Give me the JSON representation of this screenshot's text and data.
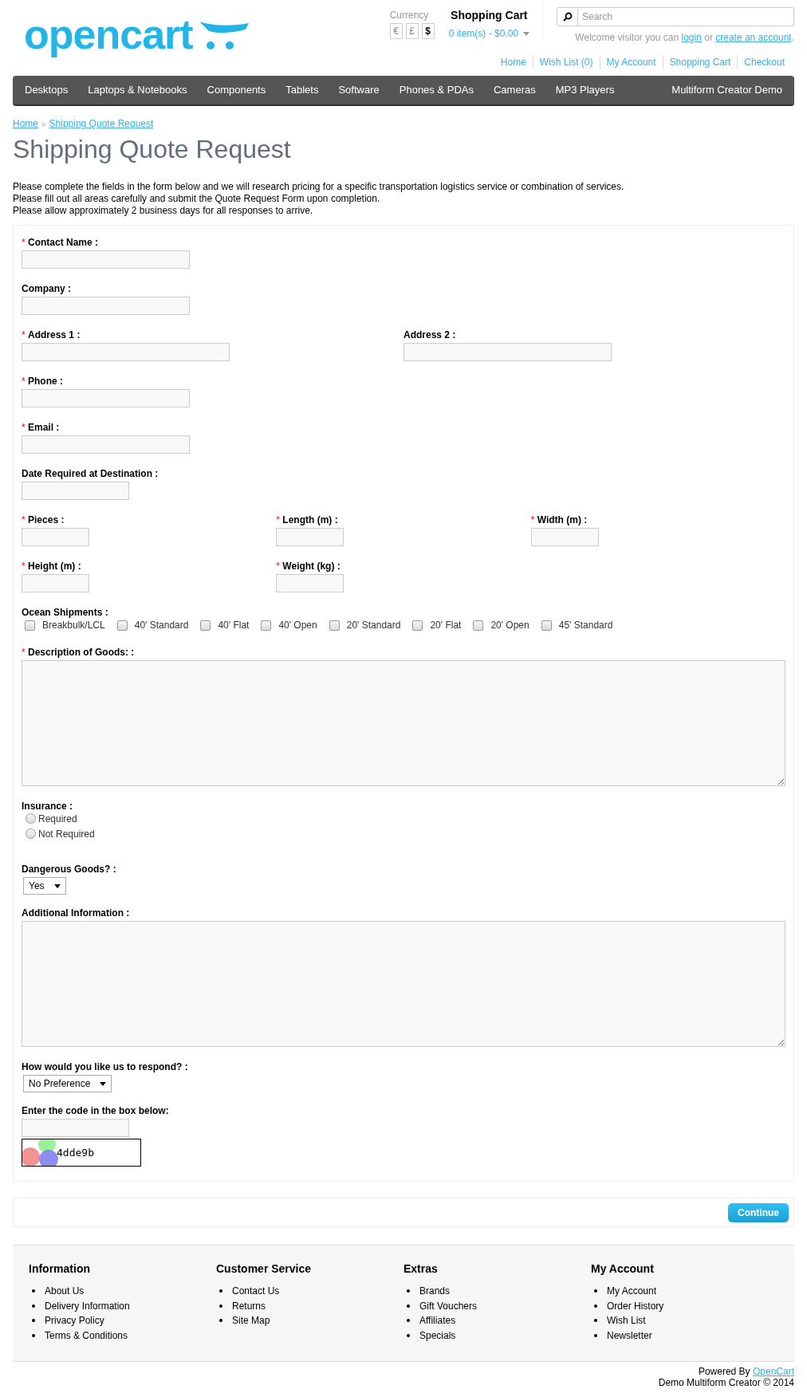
{
  "header": {
    "logo": "opencart",
    "currency": {
      "label": "Currency",
      "options": [
        {
          "symbol": "€",
          "selected": false
        },
        {
          "symbol": "£",
          "selected": false
        },
        {
          "symbol": "$",
          "selected": true
        }
      ]
    },
    "cart": {
      "title": "Shopping Cart",
      "summary": "0 item(s) - $0.00"
    },
    "search": {
      "placeholder": "Search"
    },
    "welcome": {
      "before": "Welcome visitor you can",
      "login": "login",
      "middle": "or",
      "register": "create an account",
      "after": "."
    },
    "links": [
      "Home",
      "Wish List (0)",
      "My Account",
      "Shopping Cart",
      "Checkout"
    ]
  },
  "nav": {
    "items": [
      "Desktops",
      "Laptops & Notebooks",
      "Components",
      "Tablets",
      "Software",
      "Phones & PDAs",
      "Cameras",
      "MP3 Players"
    ],
    "right": "Multiform Creator Demo"
  },
  "breadcrumb": [
    "Home",
    "Shipping Quote Request"
  ],
  "breadcrumb_separator": "»",
  "required_mark": "*",
  "title": "Shipping Quote Request",
  "intro": [
    "Please complete the fields in the form below and we will research pricing for a specific transportation logistics service or combination of services.",
    "Please fill out all areas carefully and submit the Quote Request Form upon completion.",
    "Please allow approximately 2 business days for all responses to arrive."
  ],
  "form": {
    "rows": [
      {
        "fields": [
          {
            "kind": "text",
            "label": "Contact Name :",
            "required": true
          }
        ]
      },
      {
        "fields": [
          {
            "kind": "text",
            "label": "Company :",
            "required": false
          }
        ]
      },
      {
        "fields": [
          {
            "kind": "text",
            "label": "Address 1 :",
            "required": true
          },
          {
            "kind": "text",
            "label": "Address 2 :",
            "required": false
          }
        ]
      },
      {
        "fields": [
          {
            "kind": "text",
            "label": "Phone :",
            "required": true
          }
        ]
      },
      {
        "fields": [
          {
            "kind": "text",
            "label": "Email :",
            "required": true
          }
        ]
      },
      {
        "fields": [
          {
            "kind": "date",
            "label": "Date Required at Destination :",
            "required": false
          }
        ]
      },
      {
        "fields": [
          {
            "kind": "number",
            "label": "Pieces :",
            "required": true
          },
          {
            "kind": "number",
            "label": "Length (m) :",
            "required": true
          },
          {
            "kind": "number",
            "label": "Width (m) :",
            "required": true
          }
        ]
      },
      {
        "fields": [
          {
            "kind": "number",
            "label": "Height (m) :",
            "required": true
          },
          {
            "kind": "number",
            "label": "Weight (kg) :",
            "required": true
          },
          {
            "kind": "spacer"
          }
        ]
      },
      {
        "fields": [
          {
            "kind": "checkboxes",
            "label": "Ocean Shipments :",
            "required": false,
            "options": [
              {
                "label": "Breakbulk/LCL",
                "checked": false
              },
              {
                "label": "40' Standard",
                "checked": false
              },
              {
                "label": "40' Flat",
                "checked": false
              },
              {
                "label": "40' Open",
                "checked": false
              },
              {
                "label": "20' Standard",
                "checked": false
              },
              {
                "label": "20' Flat",
                "checked": false
              },
              {
                "label": "20' Open",
                "checked": false
              },
              {
                "label": "45' Standard",
                "checked": false
              }
            ]
          }
        ]
      },
      {
        "fields": [
          {
            "kind": "textarea",
            "label": "Description of Goods: :",
            "required": true
          }
        ]
      },
      {
        "fields": [
          {
            "kind": "radios",
            "label": "Insurance :",
            "required": false,
            "options": [
              {
                "label": "Required",
                "selected": false
              },
              {
                "label": "Not Required",
                "selected": false
              }
            ]
          }
        ]
      },
      {
        "fields": [
          {
            "kind": "select",
            "label": "Dangerous Goods? :",
            "required": false,
            "value": "Yes"
          }
        ]
      },
      {
        "fields": [
          {
            "kind": "textarea",
            "label": "Additional Information :",
            "required": false
          }
        ]
      },
      {
        "fields": [
          {
            "kind": "select",
            "label": "How would you like us to respond? :",
            "required": false,
            "value": "No Preference"
          }
        ]
      },
      {
        "fields": [
          {
            "kind": "captcha",
            "label": "Enter the code in the box below:",
            "required": false,
            "code": "4dde9b"
          }
        ]
      }
    ],
    "submit": "Continue"
  },
  "footer": {
    "columns": [
      {
        "title": "Information",
        "links": [
          "About Us",
          "Delivery Information",
          "Privacy Policy",
          "Terms & Conditions"
        ]
      },
      {
        "title": "Customer Service",
        "links": [
          "Contact Us",
          "Returns",
          "Site Map"
        ]
      },
      {
        "title": "Extras",
        "links": [
          "Brands",
          "Gift Vouchers",
          "Affiliates",
          "Specials"
        ]
      },
      {
        "title": "My Account",
        "links": [
          "My Account",
          "Order History",
          "Wish List",
          "Newsletter"
        ]
      }
    ],
    "powered_by": "Powered By",
    "powered_link": "OpenCart",
    "copyright": "Demo Multiform Creator © 2014"
  }
}
